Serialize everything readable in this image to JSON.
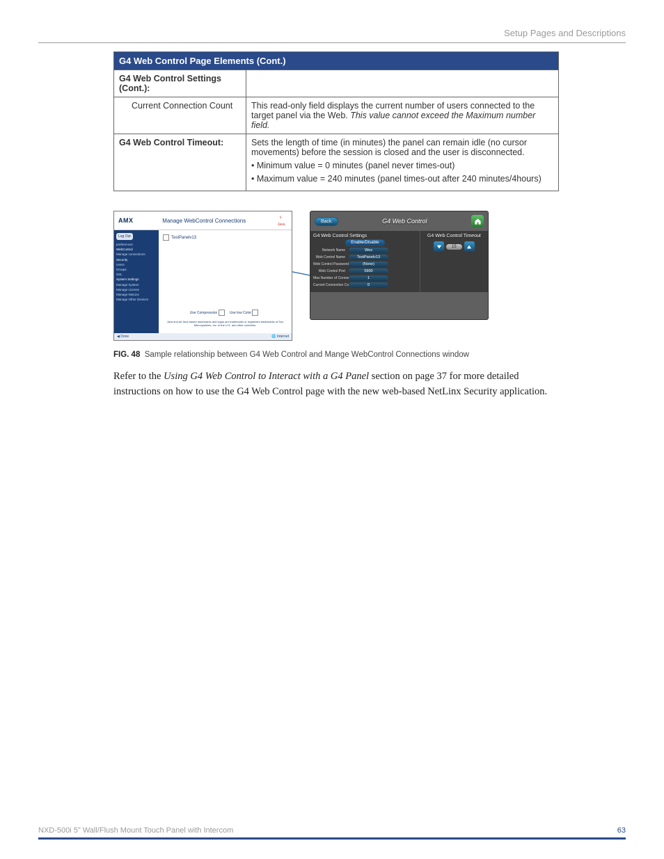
{
  "header": {
    "right_text": "Setup Pages and Descriptions"
  },
  "table": {
    "title": "G4 Web Control Page Elements (Cont.)",
    "rows": [
      {
        "label": "G4 Web Control Settings (Cont.):",
        "desc": "",
        "bold": true
      },
      {
        "label": "Current Connection Count",
        "desc": "This read-only field displays the current number of users connected to the target panel via the Web.",
        "desc_italic_tail": " This value cannot exceed the Maximum number field.",
        "indent": true
      },
      {
        "label": "G4 Web Control Timeout:",
        "desc": "Sets the length of time (in minutes) the panel can remain idle (no cursor movements) before the session is closed and the user is disconnected.",
        "bullets": [
          "Minimum value = 0 minutes (panel never times-out)",
          "Maximum value = 240 minutes (panel times-out after 240 minutes/4hours)"
        ],
        "bold": true
      }
    ]
  },
  "figure": {
    "browser": {
      "logo": "AMX",
      "title": "Manage WebControl Connections",
      "java": "Java",
      "side_button": "Log Out",
      "side_items_a": [
        "preferences"
      ],
      "side_items_b": [
        "WebControl",
        "Manage connections"
      ],
      "side_items_c": [
        "Security",
        "Users",
        "Groups",
        "SSL"
      ],
      "side_items_d": [
        "System Settings",
        "Manage System",
        "Manage License",
        "Manage NetLinx",
        "Manage Other Devices"
      ],
      "link": "TestPanelv13",
      "lower_l": "Use Compression",
      "lower_r": "Use low Color",
      "foot_done": "Done",
      "foot_net": "Internet",
      "fineprint": "Java and all Java based trademarks and logos are trademarks or registered trademarks of Sun Microsystems, Inc. in the U.S. and other countries."
    },
    "panel": {
      "back": "Back",
      "title": "G4 Web Control",
      "col1_title": "G4 Web Control Settings",
      "col2_title": "G4 Web Control Timeout",
      "toggle": "Enable/Disable",
      "rows": [
        {
          "l": "Network Name",
          "v": "Wes"
        },
        {
          "l": "Web Control Name",
          "v": "TestPanelv13"
        },
        {
          "l": "Web Control Password",
          "v": "(None)"
        },
        {
          "l": "Web Control Port",
          "v": "5900"
        },
        {
          "l": "Max Number of Connections",
          "v": "1"
        },
        {
          "l": "Current Connection Count",
          "v": "0"
        }
      ],
      "timeout_value": "15"
    },
    "caption_bold": "FIG. 48",
    "caption_rest": "Sample relationship between G4 Web Control and Mange WebControl Connections window"
  },
  "body": {
    "pre": "Refer to the ",
    "italic": "Using G4 Web Control to Interact with a G4 Panel",
    "post": " section on page 37 for more detailed instructions on how to use the G4 Web Control page with the new web-based NetLinx Security application."
  },
  "footer": {
    "product": "NXD-500i 5\" Wall/Flush Mount Touch Panel with Intercom",
    "page": "63"
  }
}
